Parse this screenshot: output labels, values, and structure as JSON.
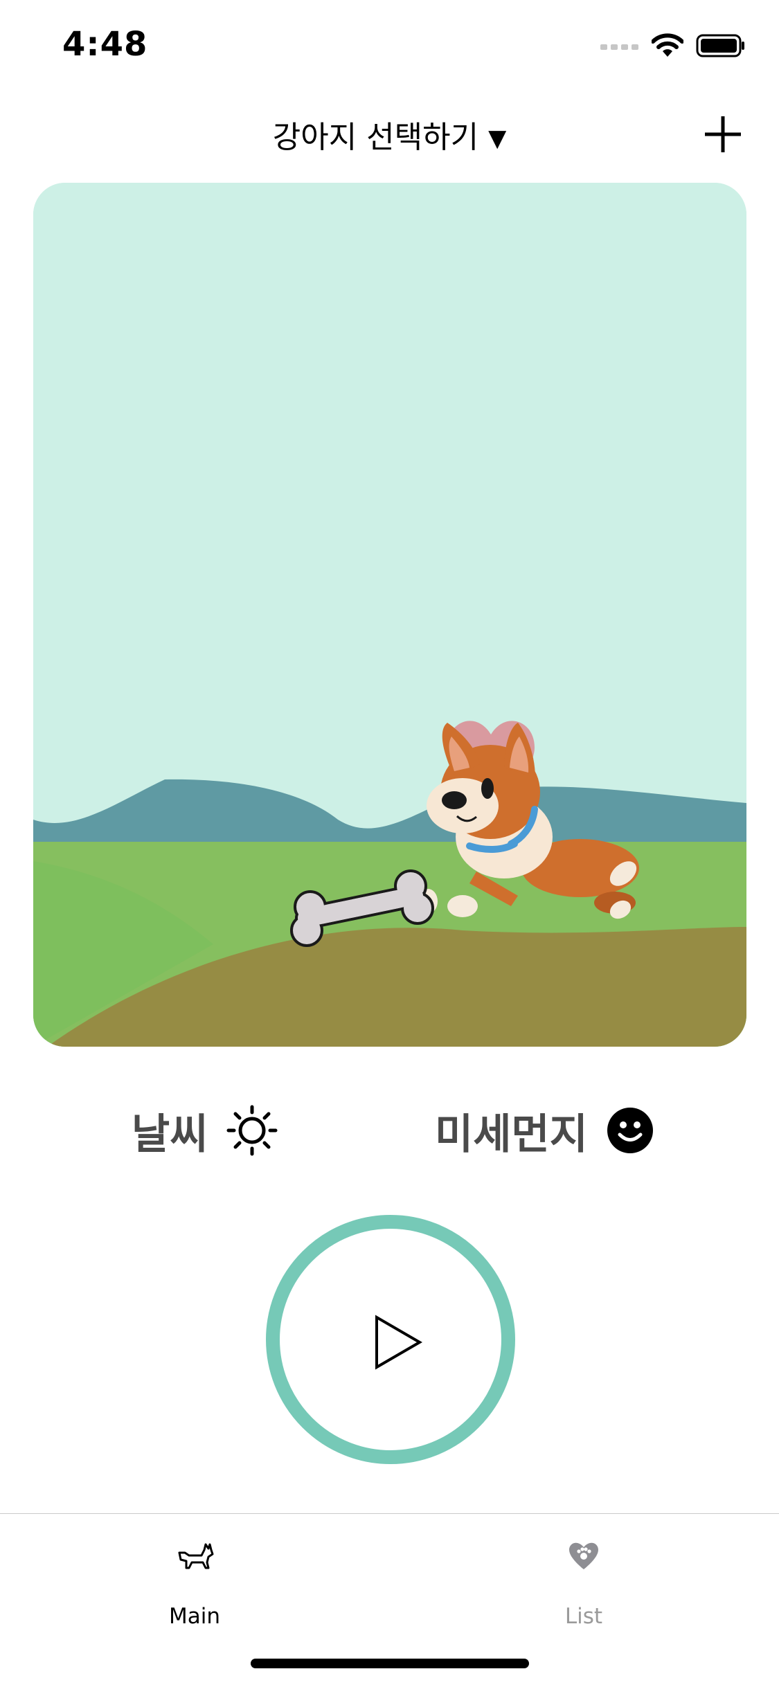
{
  "status_bar": {
    "time": "4:48"
  },
  "header": {
    "dog_selector_label": "강아지 선택하기",
    "dropdown_arrow": "▼",
    "add_icon": "plus-icon"
  },
  "status": {
    "weather_label": "날씨",
    "weather_icon": "sun-icon",
    "dust_label": "미세먼지",
    "dust_icon": "smiley-icon"
  },
  "player": {
    "play_icon": "play-icon"
  },
  "tabs": [
    {
      "label": "Main",
      "icon": "dog-icon",
      "selected": true
    },
    {
      "label": "List",
      "icon": "heart-paw-icon",
      "selected": false
    }
  ],
  "colors": {
    "accent": "#76c9b7",
    "sky": "#cdf0e6",
    "grass": "#86bf5f",
    "mountain": "#5f9aa3",
    "heart": "#d99a9f"
  }
}
